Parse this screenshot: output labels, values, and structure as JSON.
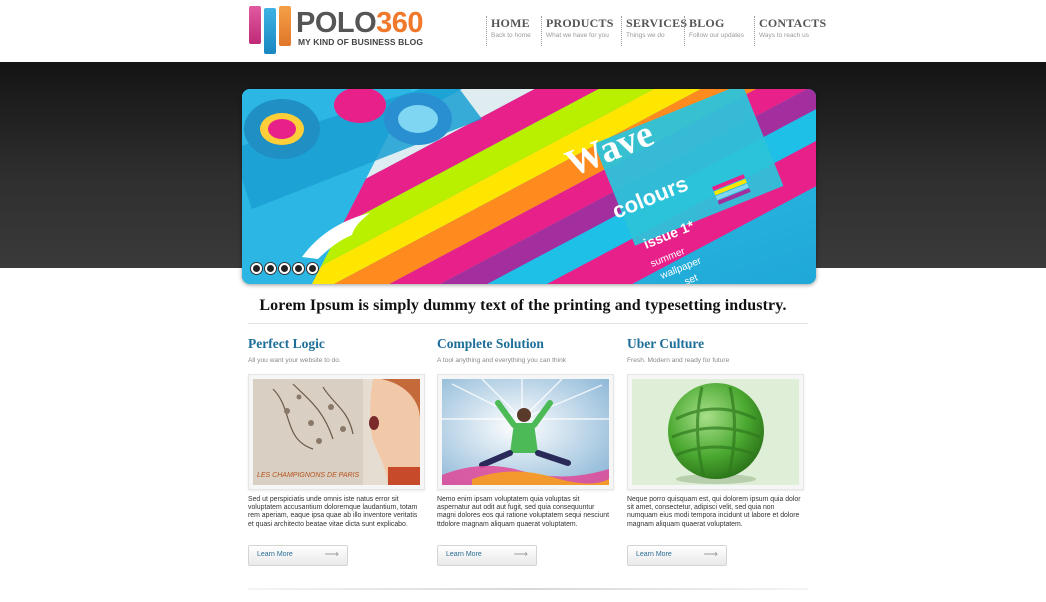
{
  "logo": {
    "name_part1": "POLO",
    "name_part2": "360",
    "tagline": "MY KIND OF BUSINESS BLOG"
  },
  "nav": [
    {
      "label": "HOME",
      "sub": "Back to home"
    },
    {
      "label": "PRODUCTS",
      "sub": "What we have for you"
    },
    {
      "label": "SERVICES",
      "sub": "Things we do"
    },
    {
      "label": "BLOG",
      "sub": "Follow our updates"
    },
    {
      "label": "CONTACTS",
      "sub": "Ways to reach us"
    }
  ],
  "slider": {
    "artwork_text": {
      "word1": "Wave",
      "word2": "colours",
      "word3": "issue 1*",
      "word4": "summer",
      "word5": "wallpaper",
      "word6": "set"
    },
    "slide_count": 5
  },
  "tagline": "Lorem Ipsum is simply dummy text of the printing and typesetting industry.",
  "features": [
    {
      "title": "Perfect Logic",
      "subtitle": "All you want your website to do.",
      "body": "Sed ut perspiciatis unde omnis iste natus error sit voluptatem accusantium doloremque laudantium, totam rem aperiam, eaque ipsa quae ab illo inventore veritatis et quasi architecto beatae vitae dicta sunt explicabo.",
      "button": "Learn More",
      "image_text": "LES CHAMPIGNONS DE PARIS"
    },
    {
      "title": "Complete Solution",
      "subtitle": "A tool anything and everything you can think",
      "body": "Nemo enim ipsam voluptatem quia voluptas sit aspernatur aut odit aut fugit, sed quia consequuntur magni dolores eos qui ratione voluptatem sequi nesciunt ttdolore magnam aliquam quaerat voluptatem.",
      "button": "Learn More"
    },
    {
      "title": "Uber Culture",
      "subtitle": "Fresh. Modern and ready for future",
      "body": "Neque porro quisquam est, qui dolorem ipsum quia dolor sit amet, consectetur, adipisci velit, sed quia non numquam eius modi tempora incidunt ut labore et dolore magnam aliquam quaerat voluptatem.",
      "button": "Learn More"
    }
  ],
  "colors": {
    "title_blue": "#1d6e98",
    "logo_orange": "#f0782a",
    "band_dark": "#1a1a1a"
  },
  "icons": {
    "button_arrow": "arrow-right-icon"
  }
}
